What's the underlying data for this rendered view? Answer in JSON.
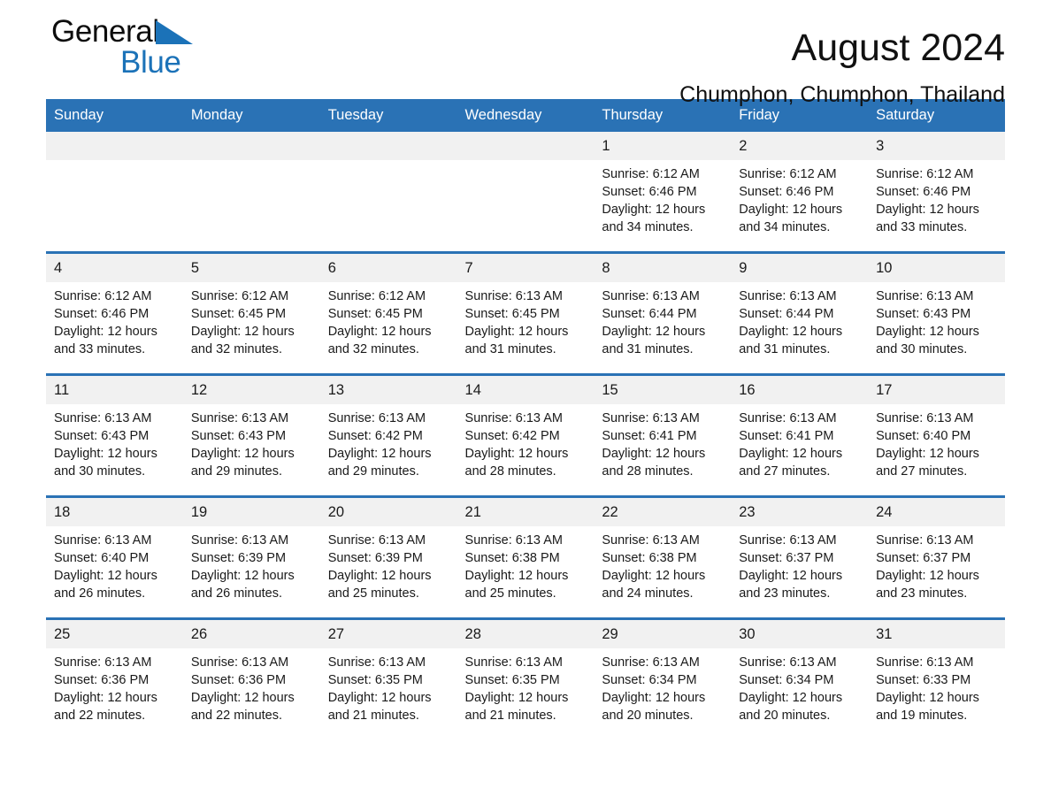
{
  "brand": {
    "name_part1": "General",
    "name_part2": "Blue",
    "triangle_color": "#1b72b8"
  },
  "header": {
    "month_title": "August 2024",
    "location": "Chumphon, Chumphon, Thailand",
    "header_bg_color": "#2a72b5",
    "daynum_bg_color": "#f1f1f1"
  },
  "weekday_headers": [
    "Sunday",
    "Monday",
    "Tuesday",
    "Wednesday",
    "Thursday",
    "Friday",
    "Saturday"
  ],
  "labels": {
    "sunrise_prefix": "Sunrise:",
    "sunset_prefix": "Sunset:",
    "daylight_prefix": "Daylight:"
  },
  "weeks": [
    [
      {
        "day": "",
        "sunrise": "",
        "sunset": "",
        "daylight_l1": "",
        "daylight_l2": ""
      },
      {
        "day": "",
        "sunrise": "",
        "sunset": "",
        "daylight_l1": "",
        "daylight_l2": ""
      },
      {
        "day": "",
        "sunrise": "",
        "sunset": "",
        "daylight_l1": "",
        "daylight_l2": ""
      },
      {
        "day": "",
        "sunrise": "",
        "sunset": "",
        "daylight_l1": "",
        "daylight_l2": ""
      },
      {
        "day": "1",
        "sunrise": "Sunrise: 6:12 AM",
        "sunset": "Sunset: 6:46 PM",
        "daylight_l1": "Daylight: 12 hours",
        "daylight_l2": "and 34 minutes."
      },
      {
        "day": "2",
        "sunrise": "Sunrise: 6:12 AM",
        "sunset": "Sunset: 6:46 PM",
        "daylight_l1": "Daylight: 12 hours",
        "daylight_l2": "and 34 minutes."
      },
      {
        "day": "3",
        "sunrise": "Sunrise: 6:12 AM",
        "sunset": "Sunset: 6:46 PM",
        "daylight_l1": "Daylight: 12 hours",
        "daylight_l2": "and 33 minutes."
      }
    ],
    [
      {
        "day": "4",
        "sunrise": "Sunrise: 6:12 AM",
        "sunset": "Sunset: 6:46 PM",
        "daylight_l1": "Daylight: 12 hours",
        "daylight_l2": "and 33 minutes."
      },
      {
        "day": "5",
        "sunrise": "Sunrise: 6:12 AM",
        "sunset": "Sunset: 6:45 PM",
        "daylight_l1": "Daylight: 12 hours",
        "daylight_l2": "and 32 minutes."
      },
      {
        "day": "6",
        "sunrise": "Sunrise: 6:12 AM",
        "sunset": "Sunset: 6:45 PM",
        "daylight_l1": "Daylight: 12 hours",
        "daylight_l2": "and 32 minutes."
      },
      {
        "day": "7",
        "sunrise": "Sunrise: 6:13 AM",
        "sunset": "Sunset: 6:45 PM",
        "daylight_l1": "Daylight: 12 hours",
        "daylight_l2": "and 31 minutes."
      },
      {
        "day": "8",
        "sunrise": "Sunrise: 6:13 AM",
        "sunset": "Sunset: 6:44 PM",
        "daylight_l1": "Daylight: 12 hours",
        "daylight_l2": "and 31 minutes."
      },
      {
        "day": "9",
        "sunrise": "Sunrise: 6:13 AM",
        "sunset": "Sunset: 6:44 PM",
        "daylight_l1": "Daylight: 12 hours",
        "daylight_l2": "and 31 minutes."
      },
      {
        "day": "10",
        "sunrise": "Sunrise: 6:13 AM",
        "sunset": "Sunset: 6:43 PM",
        "daylight_l1": "Daylight: 12 hours",
        "daylight_l2": "and 30 minutes."
      }
    ],
    [
      {
        "day": "11",
        "sunrise": "Sunrise: 6:13 AM",
        "sunset": "Sunset: 6:43 PM",
        "daylight_l1": "Daylight: 12 hours",
        "daylight_l2": "and 30 minutes."
      },
      {
        "day": "12",
        "sunrise": "Sunrise: 6:13 AM",
        "sunset": "Sunset: 6:43 PM",
        "daylight_l1": "Daylight: 12 hours",
        "daylight_l2": "and 29 minutes."
      },
      {
        "day": "13",
        "sunrise": "Sunrise: 6:13 AM",
        "sunset": "Sunset: 6:42 PM",
        "daylight_l1": "Daylight: 12 hours",
        "daylight_l2": "and 29 minutes."
      },
      {
        "day": "14",
        "sunrise": "Sunrise: 6:13 AM",
        "sunset": "Sunset: 6:42 PM",
        "daylight_l1": "Daylight: 12 hours",
        "daylight_l2": "and 28 minutes."
      },
      {
        "day": "15",
        "sunrise": "Sunrise: 6:13 AM",
        "sunset": "Sunset: 6:41 PM",
        "daylight_l1": "Daylight: 12 hours",
        "daylight_l2": "and 28 minutes."
      },
      {
        "day": "16",
        "sunrise": "Sunrise: 6:13 AM",
        "sunset": "Sunset: 6:41 PM",
        "daylight_l1": "Daylight: 12 hours",
        "daylight_l2": "and 27 minutes."
      },
      {
        "day": "17",
        "sunrise": "Sunrise: 6:13 AM",
        "sunset": "Sunset: 6:40 PM",
        "daylight_l1": "Daylight: 12 hours",
        "daylight_l2": "and 27 minutes."
      }
    ],
    [
      {
        "day": "18",
        "sunrise": "Sunrise: 6:13 AM",
        "sunset": "Sunset: 6:40 PM",
        "daylight_l1": "Daylight: 12 hours",
        "daylight_l2": "and 26 minutes."
      },
      {
        "day": "19",
        "sunrise": "Sunrise: 6:13 AM",
        "sunset": "Sunset: 6:39 PM",
        "daylight_l1": "Daylight: 12 hours",
        "daylight_l2": "and 26 minutes."
      },
      {
        "day": "20",
        "sunrise": "Sunrise: 6:13 AM",
        "sunset": "Sunset: 6:39 PM",
        "daylight_l1": "Daylight: 12 hours",
        "daylight_l2": "and 25 minutes."
      },
      {
        "day": "21",
        "sunrise": "Sunrise: 6:13 AM",
        "sunset": "Sunset: 6:38 PM",
        "daylight_l1": "Daylight: 12 hours",
        "daylight_l2": "and 25 minutes."
      },
      {
        "day": "22",
        "sunrise": "Sunrise: 6:13 AM",
        "sunset": "Sunset: 6:38 PM",
        "daylight_l1": "Daylight: 12 hours",
        "daylight_l2": "and 24 minutes."
      },
      {
        "day": "23",
        "sunrise": "Sunrise: 6:13 AM",
        "sunset": "Sunset: 6:37 PM",
        "daylight_l1": "Daylight: 12 hours",
        "daylight_l2": "and 23 minutes."
      },
      {
        "day": "24",
        "sunrise": "Sunrise: 6:13 AM",
        "sunset": "Sunset: 6:37 PM",
        "daylight_l1": "Daylight: 12 hours",
        "daylight_l2": "and 23 minutes."
      }
    ],
    [
      {
        "day": "25",
        "sunrise": "Sunrise: 6:13 AM",
        "sunset": "Sunset: 6:36 PM",
        "daylight_l1": "Daylight: 12 hours",
        "daylight_l2": "and 22 minutes."
      },
      {
        "day": "26",
        "sunrise": "Sunrise: 6:13 AM",
        "sunset": "Sunset: 6:36 PM",
        "daylight_l1": "Daylight: 12 hours",
        "daylight_l2": "and 22 minutes."
      },
      {
        "day": "27",
        "sunrise": "Sunrise: 6:13 AM",
        "sunset": "Sunset: 6:35 PM",
        "daylight_l1": "Daylight: 12 hours",
        "daylight_l2": "and 21 minutes."
      },
      {
        "day": "28",
        "sunrise": "Sunrise: 6:13 AM",
        "sunset": "Sunset: 6:35 PM",
        "daylight_l1": "Daylight: 12 hours",
        "daylight_l2": "and 21 minutes."
      },
      {
        "day": "29",
        "sunrise": "Sunrise: 6:13 AM",
        "sunset": "Sunset: 6:34 PM",
        "daylight_l1": "Daylight: 12 hours",
        "daylight_l2": "and 20 minutes."
      },
      {
        "day": "30",
        "sunrise": "Sunrise: 6:13 AM",
        "sunset": "Sunset: 6:34 PM",
        "daylight_l1": "Daylight: 12 hours",
        "daylight_l2": "and 20 minutes."
      },
      {
        "day": "31",
        "sunrise": "Sunrise: 6:13 AM",
        "sunset": "Sunset: 6:33 PM",
        "daylight_l1": "Daylight: 12 hours",
        "daylight_l2": "and 19 minutes."
      }
    ]
  ]
}
